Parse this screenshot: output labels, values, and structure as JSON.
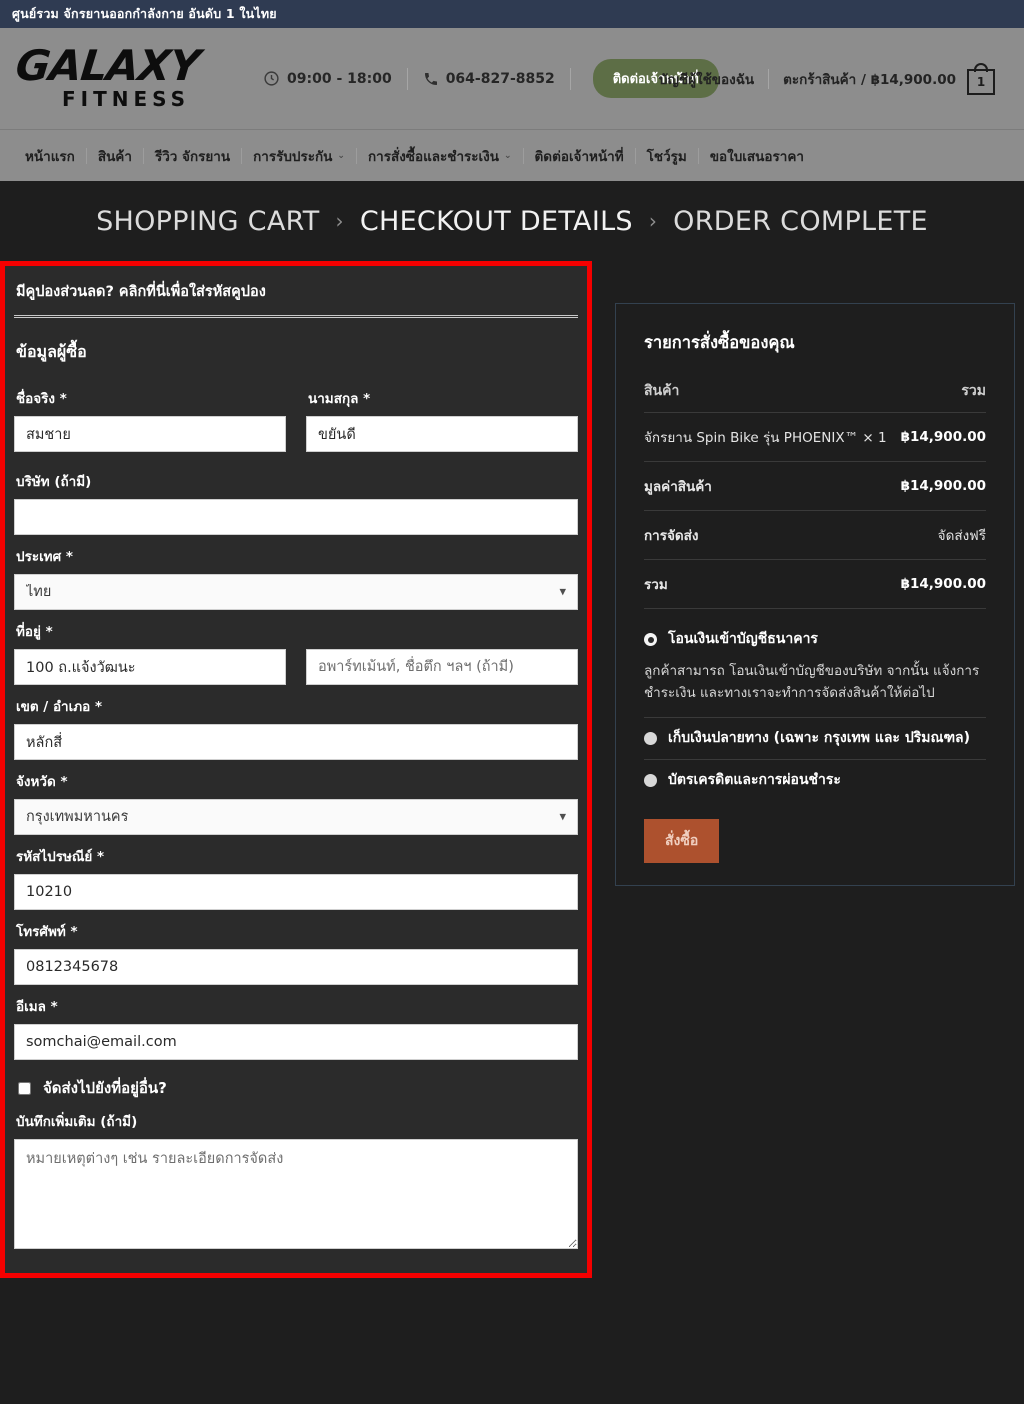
{
  "topbar": {
    "text": "ศูนย์รวม จักรยานออกกำลังกาย อันดับ 1 ในไทย"
  },
  "header": {
    "logo_main": "GALAXY",
    "logo_sub": "FITNESS",
    "hours": "09:00 - 18:00",
    "phone": "064-827-8852",
    "contact_button": "ติดต่อเจ้าหน้าที่",
    "account_link": "บัญชีผู้ใช้ของฉัน",
    "cart_label": "ตะกร้าสินค้า / ฿14,900.00",
    "cart_count": "1",
    "clock_icon": "clock-icon",
    "phone_icon": "phone-icon",
    "bag_icon": "shopping-bag-icon"
  },
  "nav": {
    "items": [
      {
        "label": "หน้าแรก",
        "caret": ""
      },
      {
        "label": "สินค้า",
        "caret": ""
      },
      {
        "label": "รีวิว จักรยาน",
        "caret": ""
      },
      {
        "label": "การรับประกัน",
        "caret": "⌄"
      },
      {
        "label": "การสั่งซื้อและชำระเงิน",
        "caret": "⌄"
      },
      {
        "label": "ติดต่อเจ้าหน้าที่",
        "caret": ""
      },
      {
        "label": "โชว์รูม",
        "caret": ""
      },
      {
        "label": "ขอใบเสนอราคา",
        "caret": ""
      }
    ]
  },
  "breadcrumb": {
    "step1": "SHOPPING CART",
    "sep1": "›",
    "step2": "CHECKOUT DETAILS",
    "sep2": "›",
    "step3": "ORDER COMPLETE"
  },
  "checkout": {
    "coupon_text": "มีคูปองส่วนลด? คลิกที่นี่เพื่อใส่รหัสคูปอง",
    "billing_title": "ข้อมูลผู้ซื้อ",
    "fields": {
      "first_name_label": "ชื่อจริง *",
      "first_name_value": "สมชาย",
      "last_name_label": "นามสกุล *",
      "last_name_value": "ขยันดี",
      "company_label": "บริษัท (ถ้ามี)",
      "company_value": "",
      "country_label": "ประเทศ *",
      "country_value": "ไทย",
      "address_label": "ที่อยู่ *",
      "address1_value": "100 ถ.แจ้งวัฒนะ",
      "address2_placeholder": "อพาร์ทเม้นท์, ชื่อตึก ฯลฯ (ถ้ามี)",
      "address2_value": "",
      "district_label": "เขต / อำเภอ *",
      "district_value": "หลักสี่",
      "province_label": "จังหวัด *",
      "province_value": "กรุงเทพมหานคร",
      "postcode_label": "รหัสไปรษณีย์ *",
      "postcode_value": "10210",
      "phone_label": "โทรศัพท์ *",
      "phone_value": "0812345678",
      "email_label": "อีเมล *",
      "email_value": "somchai@email.com",
      "ship_different_label": "จัดส่งไปยังที่อยู่อื่น?",
      "notes_label": "บันทึกเพิ่มเติม (ถ้ามี)",
      "notes_placeholder": "หมายเหตุต่างๆ เช่น รายละเอียดการจัดส่ง",
      "notes_value": ""
    },
    "country_options": [
      "ไทย"
    ],
    "province_options": [
      "กรุงเทพมหานคร"
    ]
  },
  "order": {
    "title": "รายการสั่งซื้อของคุณ",
    "col_product": "สินค้า",
    "col_total": "รวม",
    "line_items": [
      {
        "name": "จักรยาน Spin Bike รุ่น PHOENIX™ × 1",
        "total": "฿14,900.00"
      }
    ],
    "subtotal_label": "มูลค่าสินค้า",
    "subtotal_value": "฿14,900.00",
    "shipping_label": "การจัดส่ง",
    "shipping_value": "จัดส่งฟรี",
    "total_label": "รวม",
    "total_value": "฿14,900.00",
    "payment_methods": [
      {
        "label": "โอนเงินเข้าบัญชีธนาคาร",
        "selected": true,
        "description": "ลูกค้าสามารถ โอนเงินเข้าบัญชีของบริษัท จากนั้น แจ้งการชำระเงิน และทางเราจะทำการจัดส่งสินค้าให้ต่อไป"
      },
      {
        "label": "เก็บเงินปลายทาง (เฉพาะ กรุงเทพ และ ปริมณฑล)",
        "selected": false,
        "description": ""
      },
      {
        "label": "บัตรเครดิตและการผ่อนชำระ",
        "selected": false,
        "description": ""
      }
    ],
    "place_order_button": "สั่งซื้อ"
  },
  "colors": {
    "topbar_bg": "#2f3b52",
    "header_bg": "#8d8d8d",
    "page_bg": "#1e1e1e",
    "highlight_border": "#f40000",
    "accent_button": "#ad512e",
    "contact_button": "#5d6e46"
  }
}
